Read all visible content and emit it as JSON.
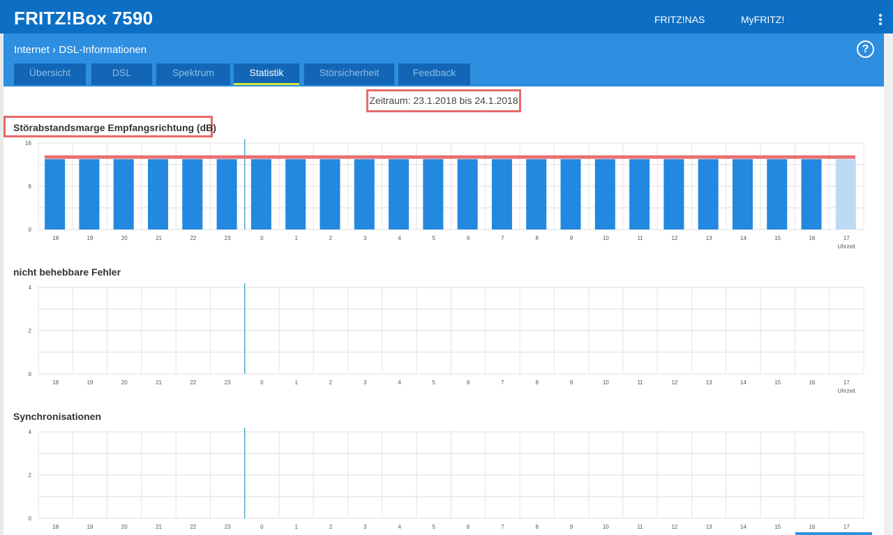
{
  "app": {
    "title": "FRITZ!Box 7590",
    "top_links": [
      "FRITZ!NAS",
      "MyFRITZ!"
    ]
  },
  "breadcrumb": {
    "parent": "Internet",
    "current": "DSL-Informationen"
  },
  "tabs": [
    {
      "label": "Übersicht",
      "active": false
    },
    {
      "label": "DSL",
      "active": false
    },
    {
      "label": "Spektrum",
      "active": false
    },
    {
      "label": "Statistik",
      "active": true
    },
    {
      "label": "Störsicherheit",
      "active": false
    },
    {
      "label": "Feedback",
      "active": false
    }
  ],
  "help_label": "?",
  "period": "Zeitraum: 23.1.2018 bis 24.1.2018",
  "colors": {
    "bar": "#2388e0",
    "bar_current": "#bcdaf4",
    "marker_line": "#2d9cbf",
    "threshold_line": "#e87070",
    "highlight": "#e66a6a",
    "header_dark": "#0c6fc4",
    "header_light": "#2e8ee0"
  },
  "chart_data": [
    {
      "type": "bar",
      "title": "Störabstandsmarge Empfangsrichtung (dB)",
      "categories": [
        "18",
        "19",
        "20",
        "21",
        "22",
        "23",
        "0",
        "1",
        "2",
        "3",
        "4",
        "5",
        "6",
        "7",
        "8",
        "9",
        "10",
        "11",
        "12",
        "13",
        "14",
        "15",
        "16",
        "17"
      ],
      "values": [
        13,
        13,
        13,
        13,
        13,
        13,
        13,
        13,
        13,
        13,
        13,
        13,
        13,
        13,
        13,
        13,
        13,
        13,
        13,
        13,
        13,
        13,
        13,
        13
      ],
      "current_index": 23,
      "ylim": [
        0,
        16
      ],
      "yticks": [
        "0",
        "8",
        "16"
      ],
      "xlabel": "Uhrzeit",
      "threshold": 13.4,
      "grid": true
    },
    {
      "type": "bar",
      "title": "nicht behebbare Fehler",
      "categories": [
        "18",
        "19",
        "20",
        "21",
        "22",
        "23",
        "0",
        "1",
        "2",
        "3",
        "4",
        "5",
        "6",
        "7",
        "8",
        "9",
        "10",
        "11",
        "12",
        "13",
        "14",
        "15",
        "16",
        "17"
      ],
      "values": [
        0,
        0,
        0,
        0,
        0,
        0,
        0,
        0,
        0,
        0,
        0,
        0,
        0,
        0,
        0,
        0,
        0,
        0,
        0,
        0,
        0,
        0,
        0,
        0
      ],
      "ylim": [
        0,
        4
      ],
      "yticks": [
        "0",
        "2",
        "4"
      ],
      "xlabel": "Uhrzeit",
      "grid": true
    },
    {
      "type": "bar",
      "title": "Synchronisationen",
      "categories": [
        "18",
        "19",
        "20",
        "21",
        "22",
        "23",
        "0",
        "1",
        "2",
        "3",
        "4",
        "5",
        "6",
        "7",
        "8",
        "9",
        "10",
        "11",
        "12",
        "13",
        "14",
        "15",
        "16",
        "17"
      ],
      "values": [
        0,
        0,
        0,
        0,
        0,
        0,
        0,
        0,
        0,
        0,
        0,
        0,
        0,
        0,
        0,
        0,
        0,
        0,
        0,
        0,
        0,
        0,
        0,
        0
      ],
      "ylim": [
        0,
        4
      ],
      "yticks": [
        "0",
        "2",
        "4"
      ],
      "xlabel": "",
      "grid": true
    }
  ]
}
